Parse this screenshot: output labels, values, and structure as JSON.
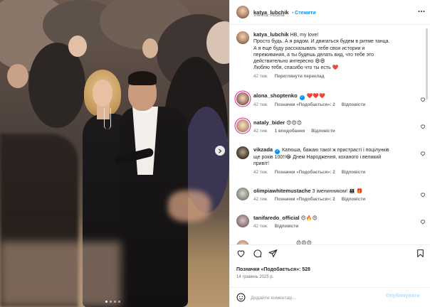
{
  "post": {
    "username": "katya_lubchik",
    "follow_label": "Стежити",
    "location": "Vienna, Austria",
    "dots": 5,
    "active_dot": 1
  },
  "caption": {
    "username": "katya_lubchik",
    "text_lines": [
      "HB, my love!",
      "Просто будь. А я рядом. И двигаться будем в ритме танца.",
      "А я еще буду рассказывать тебе свои истории и",
      "переживания, а ты будешь делать вид, что тебе это",
      "действительно интересно 😄😄",
      "Люблю тебя, спасибо что ты есть ❤️"
    ],
    "time": "42 тиж.",
    "translation_label": "Переглянути переклад"
  },
  "comments": [
    {
      "username": "alona_shoptenko",
      "verified": true,
      "text": "❤️❤️❤️",
      "time": "42 тиж.",
      "likes": "",
      "likes_label": "Позначки «Подобається»: 2",
      "reply_label": "Відповісти"
    },
    {
      "username": "nataly_bider",
      "verified": false,
      "text": "😍😍😍",
      "time": "42 тиж.",
      "likes_label": "1 вподобання",
      "reply_label": "Відповісти"
    },
    {
      "username": "vikzada",
      "verified": true,
      "text_lines": [
        "Катюша, бажаю такої ж пристрасті і поцілунків",
        "ще років 100!!😂 Днем Народження, коханого і великий",
        "привіт!"
      ],
      "time": "42 тиж.",
      "likes_label": "Позначки «Подобається»: 2",
      "reply_label": "Відповісти"
    },
    {
      "username": "olimpiawhitemustache",
      "verified": false,
      "text": "З іменинником! 👨‍👩‍👧 🎁",
      "time": "42 тиж.",
      "likes_label": "Позначки «Подобається»: 2",
      "reply_label": "Відповісти"
    },
    {
      "username": "tanifaredo_official",
      "verified": false,
      "text": "😍🔥😍",
      "time": "42 тиж.",
      "reply_label": "Відповісти"
    },
    {
      "username": "",
      "text": "😍😍😍",
      "partial": true
    }
  ],
  "likes_text": "Позначки «Подобається»: 528",
  "date_text": "14 травень 2025 р.",
  "add_comment_placeholder": "Додайте коментар...",
  "post_button": "Опублікувати"
}
